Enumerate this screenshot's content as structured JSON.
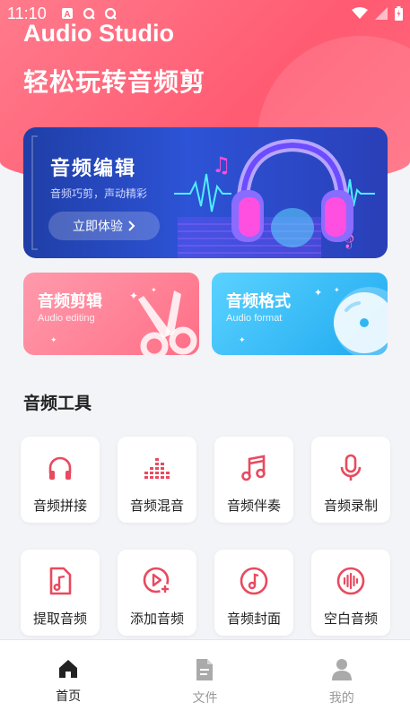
{
  "status_bar": {
    "time": "11:10",
    "left_icons": [
      "a-icon",
      "q-icon",
      "q-icon"
    ],
    "right_icons": [
      "wifi-icon",
      "signal-icon",
      "battery-icon"
    ]
  },
  "header": {
    "app_title": "Audio Studio",
    "slogan": "轻松玩转音频剪"
  },
  "banner": {
    "title": "音频编辑",
    "subtitle": "音频巧剪，声动精彩",
    "button_label": "立即体验",
    "icon": "headphones-illustration"
  },
  "feature_cards": [
    {
      "title": "音频剪辑",
      "subtitle": "Audio editing",
      "icon": "scissors-icon",
      "color": "#ff7a90"
    },
    {
      "title": "音频格式",
      "subtitle": "Audio format",
      "icon": "disc-icon",
      "color": "#33bdf7"
    }
  ],
  "tools_section": {
    "title": "音频工具",
    "accent": "#e84a5f",
    "items": [
      {
        "label": "音频拼接",
        "icon": "headphones-icon"
      },
      {
        "label": "音频混音",
        "icon": "equalizer-icon"
      },
      {
        "label": "音频伴奏",
        "icon": "music-note-icon"
      },
      {
        "label": "音频录制",
        "icon": "microphone-icon"
      },
      {
        "label": "提取音频",
        "icon": "audio-file-icon"
      },
      {
        "label": "添加音频",
        "icon": "add-audio-icon"
      },
      {
        "label": "音频封面",
        "icon": "music-disc-icon"
      },
      {
        "label": "空白音频",
        "icon": "soundwave-icon"
      }
    ]
  },
  "bottom_nav": {
    "items": [
      {
        "label": "首页",
        "icon": "home-icon",
        "active": true
      },
      {
        "label": "文件",
        "icon": "file-icon",
        "active": false
      },
      {
        "label": "我的",
        "icon": "user-icon",
        "active": false
      }
    ]
  }
}
